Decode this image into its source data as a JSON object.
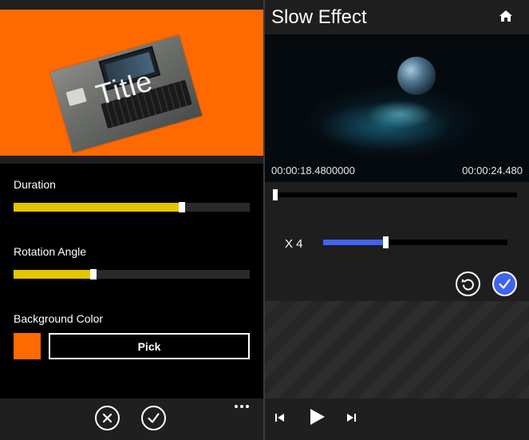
{
  "left": {
    "preview": {
      "title_text": "Title",
      "background_color": "#ff6a00"
    },
    "duration": {
      "label": "Duration",
      "value": 0.713
    },
    "rotation": {
      "label": "Rotation Angle",
      "value": 0.338
    },
    "background": {
      "label": "Background Color",
      "color": "#ff6a00",
      "pick_label": "Pick"
    },
    "appbar": {
      "icons": [
        "cancel-icon",
        "confirm-icon",
        "more-icon"
      ]
    }
  },
  "right": {
    "title": "Slow Effect",
    "home_icon": "home-icon",
    "video": {
      "start_time": "00:00:18.4800000",
      "end_time": "00:00:24.480"
    },
    "timeline": {
      "value": 0.0
    },
    "speed": {
      "label": "X 4",
      "value": 0.337,
      "color": "#3f63f1"
    },
    "actions": {
      "icons": [
        "reset-icon",
        "apply-icon"
      ]
    },
    "player": {
      "icons": [
        "skip-previous-icon",
        "play-icon",
        "skip-next-icon"
      ]
    }
  },
  "colors": {
    "accent_orange": "#ff6a00",
    "slider_yellow": "#e3c600",
    "speed_blue": "#3f63f1"
  }
}
